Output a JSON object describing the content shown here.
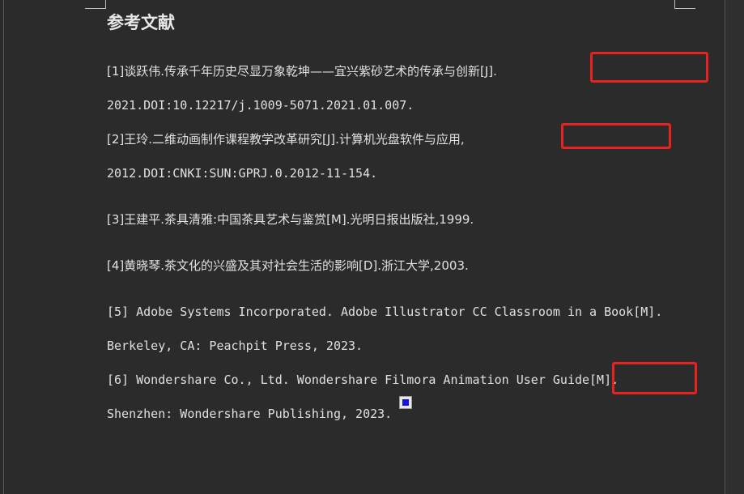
{
  "document": {
    "heading": "参考文献",
    "references": [
      {
        "line1": "[1]谈跃伟.传承千年历史尽显万象乾坤——宜兴紫砂艺术的传承与创新[J].",
        "line2": "2021.DOI:10.12217/j.1009-5071.2021.01.007."
      },
      {
        "line1": "[2]王玲.二维动画制作课程教学改革研究[J].计算机光盘软件与应用,",
        "line2": "2012.DOI:CNKI:SUN:GPRJ.0.2012-11-154."
      },
      {
        "line1": "[3]王建平.茶具清雅:中国茶具艺术与鉴赏[M].光明日报出版社,1999."
      },
      {
        "line1": "[4]黄晓琴.茶文化的兴盛及其对社会生活的影响[D].浙江大学,2003."
      },
      {
        "line1": "[5] Adobe Systems Incorporated. Adobe Illustrator CC Classroom in a Book[M].",
        "line2": "Berkeley, CA: Peachpit Press, 2023."
      },
      {
        "line1": "[6] Wondershare Co., Ltd. Wondershare Filmora Animation User Guide[M].",
        "line2": "Shenzhen: Wondershare Publishing, 2023."
      }
    ]
  },
  "colors": {
    "background": "#2b2b2b",
    "text": "#e0e0e0",
    "highlight_box": "#e8231f",
    "anchor_marker": "#1414e6"
  }
}
